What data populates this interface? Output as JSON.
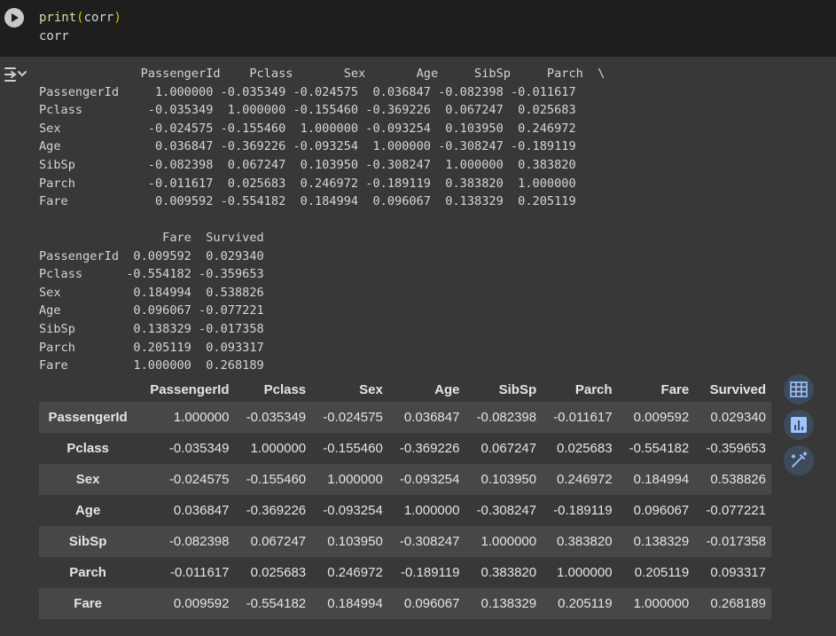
{
  "code": {
    "line1_fn": "print",
    "line1_open": "(",
    "line1_arg": "corr",
    "line1_close": ")",
    "line2": "corr"
  },
  "printed_output": {
    "block1_header": "              PassengerId    Pclass       Sex       Age     SibSp     Parch  \\",
    "block1_rows": [
      "PassengerId     1.000000 -0.035349 -0.024575  0.036847 -0.082398 -0.011617",
      "Pclass         -0.035349  1.000000 -0.155460 -0.369226  0.067247  0.025683",
      "Sex            -0.024575 -0.155460  1.000000 -0.093254  0.103950  0.246972",
      "Age             0.036847 -0.369226 -0.093254  1.000000 -0.308247 -0.189119",
      "SibSp          -0.082398  0.067247  0.103950 -0.308247  1.000000  0.383820",
      "Parch          -0.011617  0.025683  0.246972 -0.189119  0.383820  1.000000",
      "Fare            0.009592 -0.554182  0.184994  0.096067  0.138329  0.205119"
    ],
    "block2_header": "                 Fare  Survived",
    "block2_rows": [
      "PassengerId  0.009592  0.029340",
      "Pclass      -0.554182 -0.359653",
      "Sex          0.184994  0.538826",
      "Age          0.096067 -0.077221",
      "SibSp        0.138329 -0.017358",
      "Parch        0.205119  0.093317",
      "Fare         1.000000  0.268189"
    ]
  },
  "dataframe": {
    "columns": [
      "PassengerId",
      "Pclass",
      "Sex",
      "Age",
      "SibSp",
      "Parch",
      "Fare",
      "Survived"
    ],
    "rows": [
      {
        "label": "PassengerId",
        "values": [
          "1.000000",
          "-0.035349",
          "-0.024575",
          "0.036847",
          "-0.082398",
          "-0.011617",
          "0.009592",
          "0.029340"
        ]
      },
      {
        "label": "Pclass",
        "values": [
          "-0.035349",
          "1.000000",
          "-0.155460",
          "-0.369226",
          "0.067247",
          "0.025683",
          "-0.554182",
          "-0.359653"
        ]
      },
      {
        "label": "Sex",
        "values": [
          "-0.024575",
          "-0.155460",
          "1.000000",
          "-0.093254",
          "0.103950",
          "0.246972",
          "0.184994",
          "0.538826"
        ]
      },
      {
        "label": "Age",
        "values": [
          "0.036847",
          "-0.369226",
          "-0.093254",
          "1.000000",
          "-0.308247",
          "-0.189119",
          "0.096067",
          "-0.077221"
        ]
      },
      {
        "label": "SibSp",
        "values": [
          "-0.082398",
          "0.067247",
          "0.103950",
          "-0.308247",
          "1.000000",
          "0.383820",
          "0.138329",
          "-0.017358"
        ]
      },
      {
        "label": "Parch",
        "values": [
          "-0.011617",
          "0.025683",
          "0.246972",
          "-0.189119",
          "0.383820",
          "1.000000",
          "0.205119",
          "0.093317"
        ]
      },
      {
        "label": "Fare",
        "values": [
          "0.009592",
          "-0.554182",
          "0.184994",
          "0.096067",
          "0.138329",
          "0.205119",
          "1.000000",
          "0.268189"
        ]
      }
    ]
  },
  "icons": {
    "run": "play-icon",
    "output_menu": "output-menu-icon",
    "table_view": "table-icon",
    "chart_suggest": "bar-chart-icon",
    "magic_edit": "magic-wand-icon"
  }
}
